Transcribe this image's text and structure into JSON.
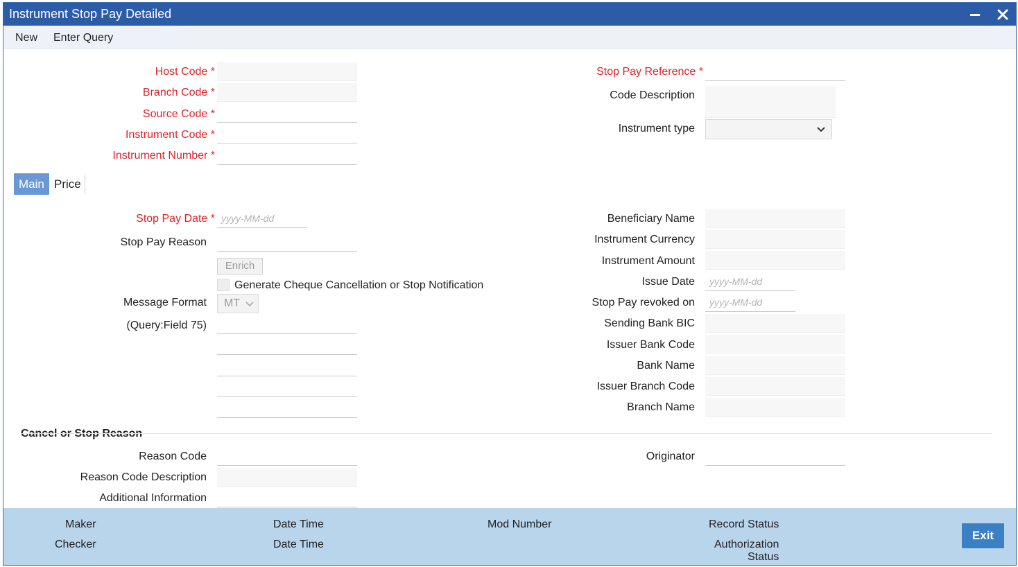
{
  "window": {
    "title": "Instrument Stop Pay Detailed"
  },
  "menu": {
    "new": "New",
    "enter_query": "Enter Query"
  },
  "header": {
    "host_code": "Host Code",
    "branch_code": "Branch Code",
    "source_code": "Source Code",
    "instrument_code": "Instrument Code",
    "instrument_number": "Instrument Number",
    "stop_pay_reference": "Stop Pay Reference",
    "code_description": "Code Description",
    "instrument_type": "Instrument type",
    "required_mark": "*"
  },
  "tabs": {
    "main": "Main",
    "price": "Price"
  },
  "main": {
    "stop_pay_date": "Stop Pay Date",
    "date_placeholder": "yyyy-MM-dd",
    "stop_pay_reason": "Stop Pay Reason",
    "enrich_button": "Enrich",
    "generate_cheque": "Generate Cheque Cancellation or Stop Notification",
    "message_format": "Message Format",
    "message_format_value": "MT",
    "query_field": "(Query:Field 75)",
    "beneficiary_name": "Beneficiary Name",
    "instrument_currency": "Instrument Currency",
    "instrument_amount": "Instrument Amount",
    "issue_date": "Issue Date",
    "stop_pay_revoked_on": "Stop Pay revoked on",
    "sending_bank_bic": "Sending Bank BIC",
    "issuer_bank_code": "Issuer Bank Code",
    "bank_name": "Bank Name",
    "issuer_branch_code": "Issuer Branch Code",
    "branch_name": "Branch Name"
  },
  "cancel_section": {
    "title": "Cancel or Stop Reason",
    "reason_code": "Reason Code",
    "reason_code_description": "Reason Code Description",
    "additional_information": "Additional Information",
    "originator": "Originator"
  },
  "footer": {
    "maker": "Maker",
    "checker": "Checker",
    "date_time_1": "Date Time",
    "date_time_2": "Date Time",
    "mod_number": "Mod Number",
    "record_status": "Record Status",
    "authorization": "Authorization",
    "status": "Status",
    "exit_button": "Exit"
  },
  "icons": {
    "minimize": "minimize-icon",
    "close": "close-icon",
    "dropdown": "chevron-down-icon"
  },
  "colors": {
    "titlebar": "#2c5ba8",
    "required": "#e0202a",
    "active_tab": "#6a98d6",
    "footer": "#b9d5ec",
    "exit_button": "#3b7fc4"
  }
}
